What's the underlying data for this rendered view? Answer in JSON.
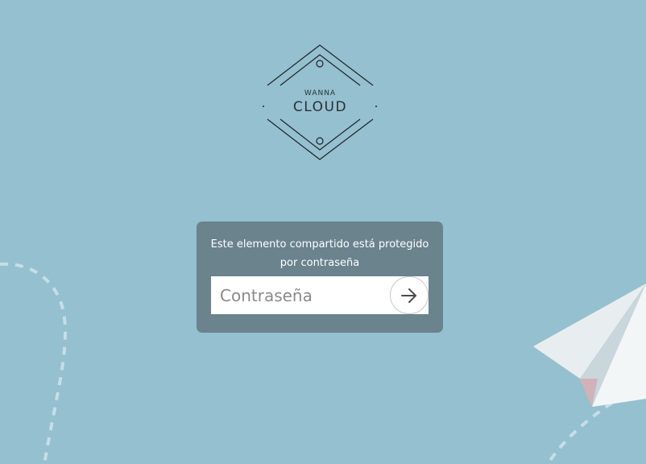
{
  "logo": {
    "small_text": "WANNA",
    "big_text": "CLOUD"
  },
  "card": {
    "message": "Este elemento compartido está protegido por contraseña",
    "password_placeholder": "Contraseña",
    "password_value": "",
    "submit_icon": "arrow-right-icon"
  },
  "colors": {
    "background": "#95c0cf",
    "card": "#6a838d",
    "logo_stroke": "#1e2226"
  }
}
